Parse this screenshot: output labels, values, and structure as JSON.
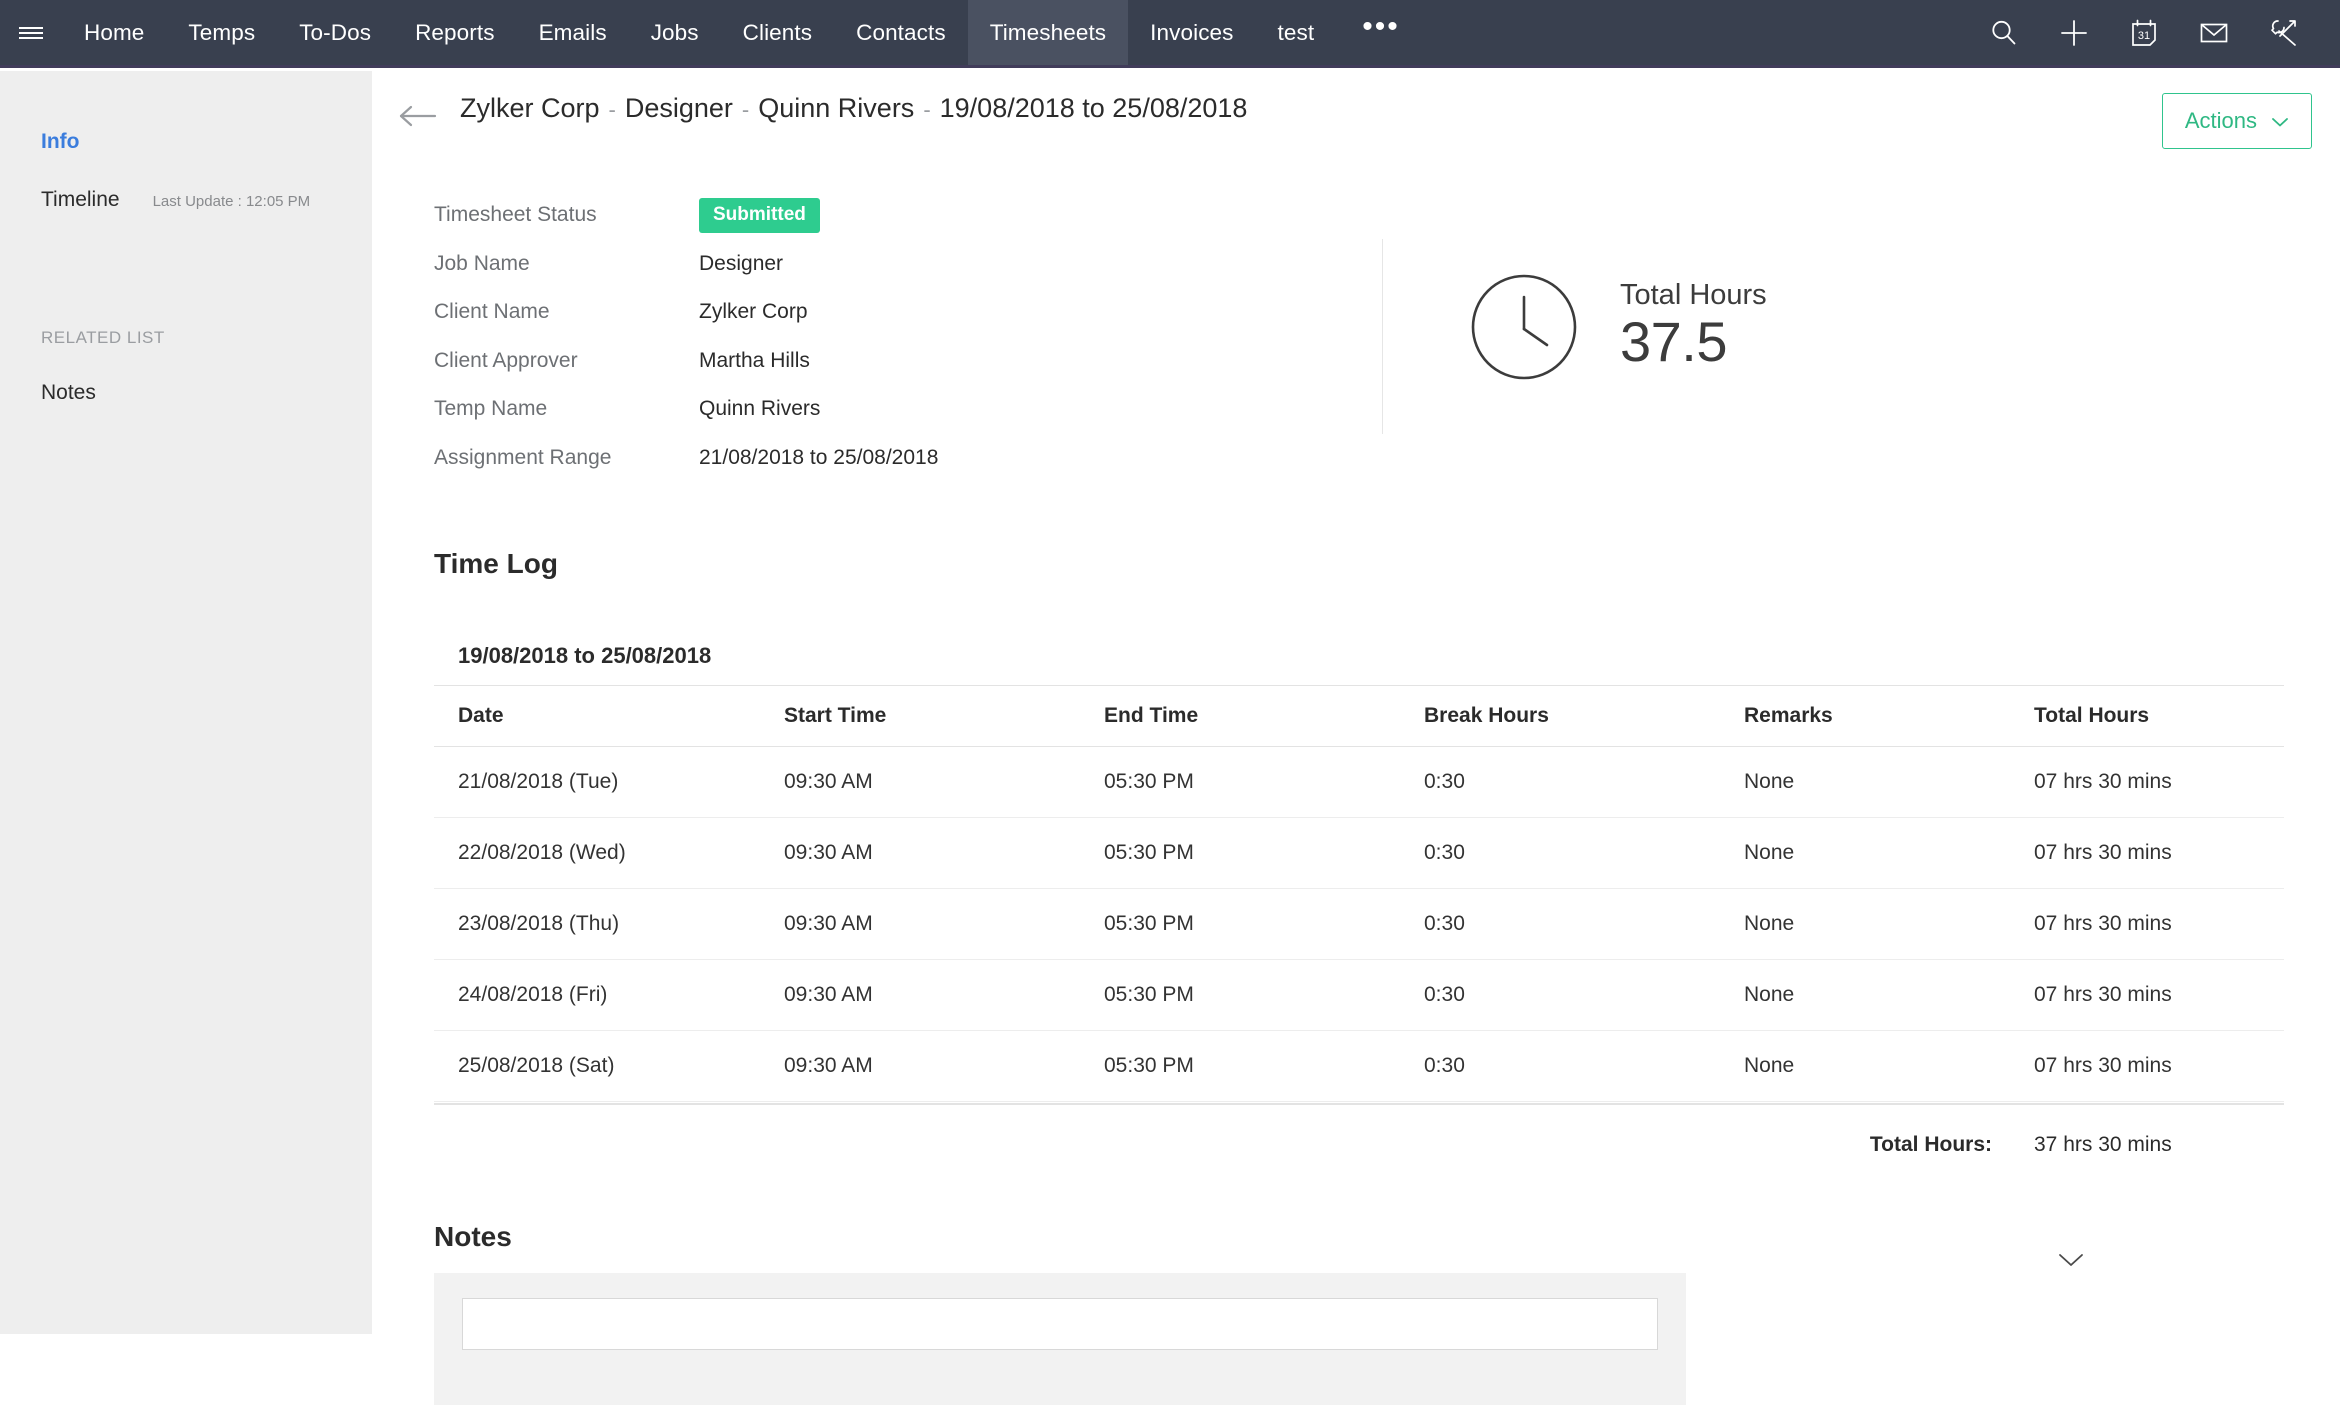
{
  "topnav": {
    "menu_icon": "hamburger-icon",
    "items": [
      {
        "label": "Home",
        "active": false
      },
      {
        "label": "Temps",
        "active": false
      },
      {
        "label": "To-Dos",
        "active": false
      },
      {
        "label": "Reports",
        "active": false
      },
      {
        "label": "Emails",
        "active": false
      },
      {
        "label": "Jobs",
        "active": false
      },
      {
        "label": "Clients",
        "active": false
      },
      {
        "label": "Contacts",
        "active": false
      },
      {
        "label": "Timesheets",
        "active": true
      },
      {
        "label": "Invoices",
        "active": false
      },
      {
        "label": "test",
        "active": false
      }
    ],
    "overflow_label": "•••",
    "icons": [
      "search-icon",
      "plus-icon",
      "calendar-icon",
      "envelope-icon",
      "tools-icon"
    ],
    "calendar_day": "31",
    "background": "#39404f",
    "active_background": "#4a5161"
  },
  "sidebar": {
    "info_label": "Info",
    "timeline_label": "Timeline",
    "last_update": "Last Update : 12:05 PM",
    "related_list_header": "RELATED LIST",
    "notes_label": "Notes",
    "active_color": "#3b7ddd",
    "background": "#eeeeee"
  },
  "header": {
    "back_icon": "back-arrow-icon",
    "breadcrumb": [
      "Zylker Corp",
      "Designer",
      "Quinn Rivers",
      "19/08/2018 to 25/08/2018"
    ],
    "separator": "-",
    "actions_label": "Actions",
    "actions_chevron": "chevron-down-icon",
    "actions_color": "#2fb883"
  },
  "details": {
    "rows": [
      {
        "label": "Timesheet Status",
        "value": "Submitted",
        "type": "badge"
      },
      {
        "label": "Job Name",
        "value": "Designer",
        "type": "text"
      },
      {
        "label": "Client Name",
        "value": "Zylker Corp",
        "type": "text"
      },
      {
        "label": "Client Approver",
        "value": "Martha Hills",
        "type": "text"
      },
      {
        "label": "Temp Name",
        "value": "Quinn Rivers",
        "type": "text"
      },
      {
        "label": "Assignment Range",
        "value": "21/08/2018 to 25/08/2018",
        "type": "text"
      }
    ],
    "status_badge_color": "#2ecc8f"
  },
  "total_hours_card": {
    "icon": "clock-icon",
    "label": "Total Hours",
    "value": "37.5"
  },
  "timelog": {
    "section_title": "Time Log",
    "range_title": "19/08/2018 to 25/08/2018",
    "columns": [
      "Date",
      "Start Time",
      "End Time",
      "Break Hours",
      "Remarks",
      "Total Hours"
    ],
    "rows": [
      {
        "date": "21/08/2018 (Tue)",
        "start": "09:30 AM",
        "end": "05:30 PM",
        "break": "0:30",
        "remarks": "None",
        "total": "07 hrs 30 mins"
      },
      {
        "date": "22/08/2018 (Wed)",
        "start": "09:30 AM",
        "end": "05:30 PM",
        "break": "0:30",
        "remarks": "None",
        "total": "07 hrs 30 mins"
      },
      {
        "date": "23/08/2018 (Thu)",
        "start": "09:30 AM",
        "end": "05:30 PM",
        "break": "0:30",
        "remarks": "None",
        "total": "07 hrs 30 mins"
      },
      {
        "date": "24/08/2018 (Fri)",
        "start": "09:30 AM",
        "end": "05:30 PM",
        "break": "0:30",
        "remarks": "None",
        "total": "07 hrs 30 mins"
      },
      {
        "date": "25/08/2018 (Sat)",
        "start": "09:30 AM",
        "end": "05:30 PM",
        "break": "0:30",
        "remarks": "None",
        "total": "07 hrs 30 mins"
      }
    ],
    "total_label": "Total Hours:",
    "total_value": "37 hrs 30 mins"
  },
  "notes": {
    "title": "Notes",
    "collapse_icon": "chevron-down-icon",
    "input_value": "",
    "input_placeholder": ""
  }
}
